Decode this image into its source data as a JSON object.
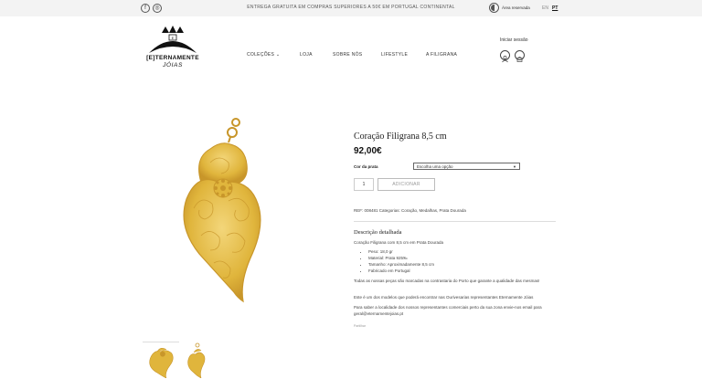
{
  "topbar": {
    "social": [
      {
        "name": "facebook-icon",
        "glyph": "f"
      },
      {
        "name": "instagram-icon",
        "glyph": "◎"
      }
    ],
    "promo": "ENTREGA GRATUITA EM COMPRAS SUPERIORES A 50€ EM PORTUGAL CONTINENTAL",
    "accessibility_label": "Área reservada",
    "languages": [
      {
        "code": "EN",
        "active": false
      },
      {
        "code": "PT",
        "active": true
      }
    ]
  },
  "logo": {
    "line1": "[E]TERNAMENTE",
    "line2": "JÓIAS"
  },
  "nav": {
    "colecoes": "COLEÇÕES",
    "loja": "LOJA",
    "sobre": "SOBRE NÓS",
    "lifestyle": "LIFESTYLE",
    "filigrana": "A FILIGRANA"
  },
  "account": {
    "login": "Iniciar sessão"
  },
  "product": {
    "title": "Coração Filigrana 8,5 cm",
    "price": "92,00€",
    "option_label": "Cor da prata",
    "option_select": "Escolha uma opção",
    "quantity": "1",
    "add_button": "ADICIONAR",
    "meta": "REF: 008481  Categorias: Coração, Medalhas, Prata Dourada"
  },
  "description": {
    "title": "Descrição detalhada",
    "intro": "Coração Filigrana com 8,5 cm em Prata Dourada",
    "bullets": [
      "Peso: 18,0 gr",
      "Material: Prata 925‰",
      "Tamanho: Aproximadamente 8,5 cm",
      "Fabricado em Portugal"
    ],
    "p1": "Todas as nossas peças são marcadas na contrastaria do Porto que garante a qualidade das mesmas!",
    "p2": "Este é um dos modelos que poderá encontrar nas Ourivesarias representantes Eternamente Jóias",
    "p3": "Para saber a localidade dos nossos representantes comerciais perto da sua zona envie-nos email para geral@eternamentejoias.pt",
    "share": "Partilhar"
  },
  "colors": {
    "gold": "#e0b53c",
    "gold_dark": "#c8962a",
    "gold_light": "#f3d67a"
  }
}
